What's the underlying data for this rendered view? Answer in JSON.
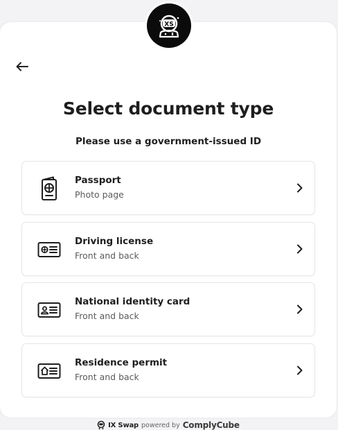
{
  "header": {
    "logo_icon": "ixswap-astronaut-logo",
    "logo_text": "XS",
    "back_icon": "arrow-left-icon"
  },
  "main": {
    "title": "Select document type",
    "subtitle": "Please use a government-issued ID"
  },
  "documents": [
    {
      "name": "Passport",
      "desc": "Photo page",
      "icon": "passport-icon"
    },
    {
      "name": "Driving license",
      "desc": "Front and back",
      "icon": "driving-license-icon"
    },
    {
      "name": "National identity card",
      "desc": "Front and back",
      "icon": "id-card-icon"
    },
    {
      "name": "Residence permit",
      "desc": "Front and back",
      "icon": "residence-permit-icon"
    }
  ],
  "footer": {
    "brand": "IX Swap",
    "powered_by": "powered by",
    "provider": "ComplyCube"
  },
  "colors": {
    "background": "#f3f3f6",
    "card": "#ffffff",
    "text": "#1e1e1e",
    "muted": "#5a5a5a",
    "border": "#e6e6e9"
  }
}
